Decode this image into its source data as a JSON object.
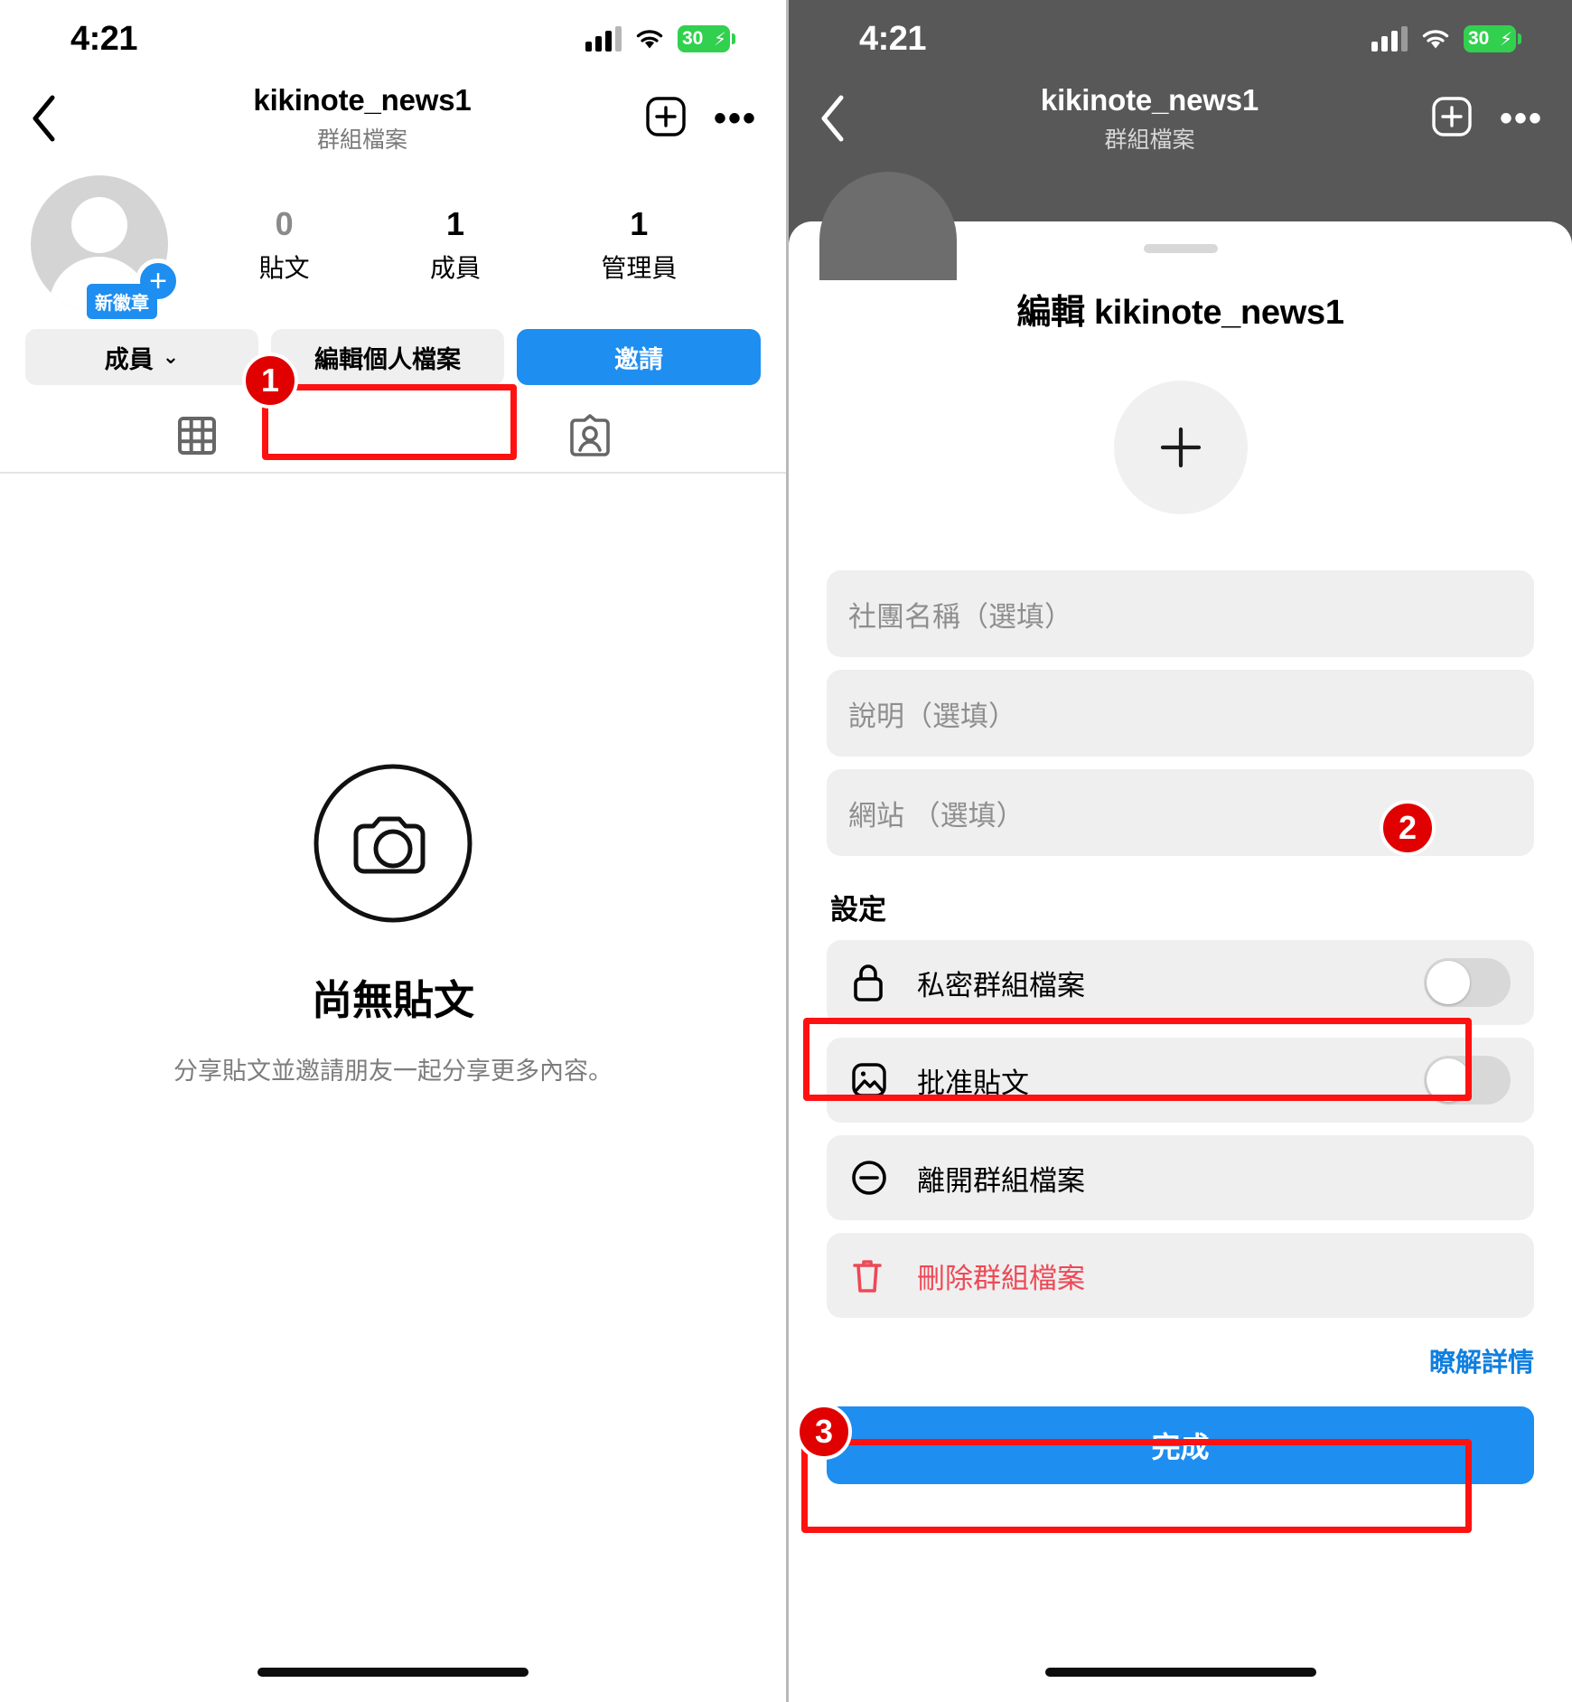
{
  "status": {
    "time": "4:21",
    "battery": "30",
    "signal_icon": "cellular-signal-icon",
    "wifi_icon": "wifi-icon",
    "battery_icon": "battery-charging-icon"
  },
  "left": {
    "nav": {
      "back_icon": "chevron-left-icon",
      "title": "kikinote_news1",
      "subtitle": "群組檔案",
      "add_icon": "plus-square-icon",
      "more_icon": "more-options-icon"
    },
    "profile": {
      "avatar_icon": "default-avatar-icon",
      "add_photo_icon": "plus-circle-icon",
      "new_badge": "新徽章",
      "stats": [
        {
          "value": "0",
          "label": "貼文"
        },
        {
          "value": "1",
          "label": "成員"
        },
        {
          "value": "1",
          "label": "管理員"
        }
      ]
    },
    "actions": {
      "members": "成員",
      "members_caret_icon": "chevron-down-icon",
      "edit_profile": "編輯個人檔案",
      "invite": "邀請"
    },
    "tabs": [
      {
        "icon": "grid-icon",
        "name": "posts-grid-tab"
      },
      {
        "icon": "tagged-person-icon",
        "name": "tagged-tab"
      }
    ],
    "empty": {
      "icon": "camera-circle-icon",
      "title": "尚無貼文",
      "subtitle": "分享貼文並邀請朋友一起分享更多內容。"
    }
  },
  "right": {
    "nav": {
      "back_icon": "chevron-left-icon",
      "title": "kikinote_news1",
      "subtitle": "群組檔案",
      "add_icon": "plus-square-icon",
      "more_icon": "more-options-icon"
    },
    "sheet": {
      "grabber_icon": "sheet-grabber-icon",
      "title": "編輯 kikinote_news1",
      "avatar_add_icon": "plus-icon",
      "fields": [
        {
          "name": "club-name-field",
          "placeholder": "社團名稱（選填）"
        },
        {
          "name": "description-field",
          "placeholder": "說明（選填）"
        },
        {
          "name": "website-field",
          "placeholder": "網站 （選填）"
        }
      ],
      "settings_heading": "設定",
      "settings": [
        {
          "name": "private-group-profile-row",
          "icon": "lock-icon",
          "label": "私密群組檔案",
          "control": "toggle",
          "on": false
        },
        {
          "name": "approve-posts-row",
          "icon": "photo-icon",
          "label": "批准貼文",
          "control": "toggle",
          "on": false
        },
        {
          "name": "leave-group-profile-row",
          "icon": "minus-circle-icon",
          "label": "離開群組檔案",
          "control": "none",
          "on": false
        },
        {
          "name": "delete-group-profile-row",
          "icon": "trash-icon",
          "label": "刪除群組檔案",
          "control": "none",
          "danger": true
        }
      ],
      "learn_more": "瞭解詳情",
      "done": "完成"
    }
  },
  "annotations": {
    "markers": [
      "1",
      "2",
      "3"
    ]
  },
  "colors": {
    "accent_blue": "#1e8ef0",
    "danger_red": "#ed4956",
    "highlight_red": "#ff1111",
    "field_gray": "#efefef",
    "battery_green": "#32d04f"
  }
}
